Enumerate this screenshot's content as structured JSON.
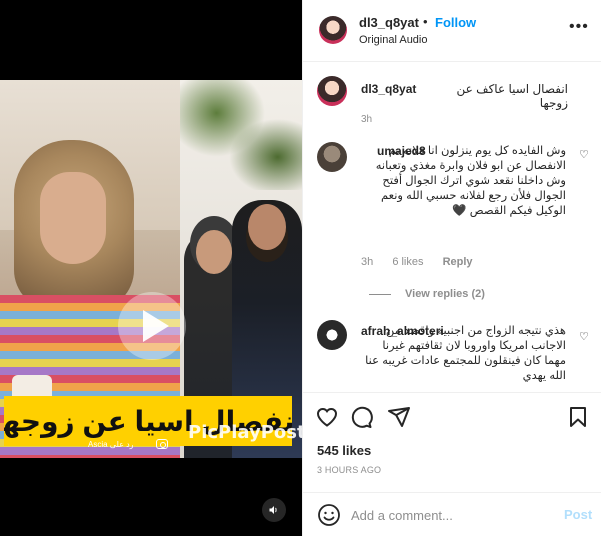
{
  "post": {
    "username": "dl3_q8yat",
    "follow_label": "Follow",
    "audio_label": "Original Audio",
    "caption": "انفصال اسيا عاكف عن زوجها",
    "caption_time": "3h",
    "likes": "545 likes",
    "time_ago": "3 HOURS AGO"
  },
  "video": {
    "banner_text": "انفصال اسيا عن زوجها",
    "watermark": "PicPlayPost",
    "credit": "رد على Ascia"
  },
  "comments": [
    {
      "username": "umajed8",
      "text": "وش الفايده كل يوم ينزلون انا فلانه تم الانفصال عن ابو فلان وابرة مغذي وتعبانه وش داخلنا نقعد شوي اترك الجوال أفتح الجوال فلأن رجع لفلانه حسبي الله ونعم الوكيل فيكم القصص 🖤",
      "time": "3h",
      "likes": "6 likes",
      "reply": "Reply",
      "view_replies": "View replies (2)"
    },
    {
      "username": "afrah_almoteri",
      "text": "هذي نتيجه الزواج من اجنبيه واقصد من الاجانب امريكا واوروبا لان ثقافتهم غيرنا مهما كان فينقلون للمجتمع عادات غريبه عنا الله يهدي"
    }
  ],
  "add_comment": {
    "placeholder": "Add a comment...",
    "post_label": "Post"
  },
  "icons": {
    "like": "heart-icon",
    "comment": "comment-icon",
    "share": "paper-plane-icon",
    "save": "bookmark-icon",
    "emoji": "smiley-icon",
    "more": "ellipsis-icon",
    "audio": "speaker-icon",
    "play": "play-icon"
  }
}
